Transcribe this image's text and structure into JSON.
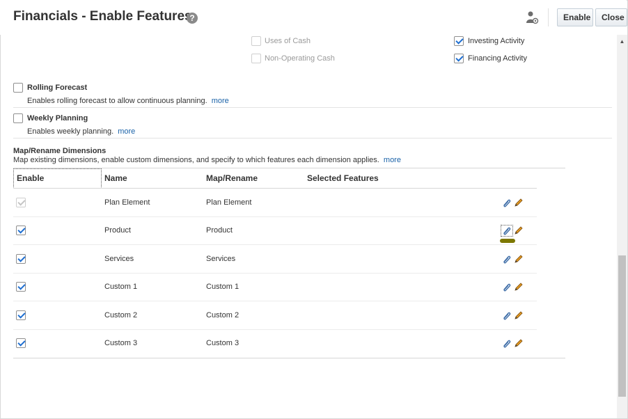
{
  "header": {
    "title": "Financials - Enable Features",
    "help_icon": "?",
    "enable_label": "Enable",
    "close_label": "Close"
  },
  "cashflow": {
    "uses_of_cash": "Uses of Cash",
    "non_operating_cash": "Non-Operating Cash",
    "investing_activity": "Investing Activity",
    "financing_activity": "Financing Activity"
  },
  "rolling_forecast": {
    "label": "Rolling Forecast",
    "description": "Enables rolling forecast to allow continuous planning.",
    "more": "more"
  },
  "weekly_planning": {
    "label": "Weekly Planning",
    "description": "Enables weekly planning.",
    "more": "more"
  },
  "map_section": {
    "title": "Map/Rename Dimensions",
    "description": "Map existing dimensions, enable custom dimensions, and specify to which features each dimension applies.",
    "more": "more"
  },
  "table": {
    "headers": {
      "enable": "Enable",
      "name": "Name",
      "map_rename": "Map/Rename",
      "selected_features": "Selected Features"
    },
    "rows": [
      {
        "enabled": true,
        "disabled": true,
        "name": "Plan Element",
        "map": "Plan Element",
        "features": ""
      },
      {
        "enabled": true,
        "disabled": false,
        "name": "Product",
        "map": "Product",
        "features": ""
      },
      {
        "enabled": true,
        "disabled": false,
        "name": "Services",
        "map": "Services",
        "features": ""
      },
      {
        "enabled": true,
        "disabled": false,
        "name": "Custom 1",
        "map": "Custom 1",
        "features": ""
      },
      {
        "enabled": true,
        "disabled": false,
        "name": "Custom 2",
        "map": "Custom 2",
        "features": ""
      },
      {
        "enabled": true,
        "disabled": false,
        "name": "Custom 3",
        "map": "Custom 3",
        "features": ""
      }
    ]
  },
  "icons": {
    "help": "help-icon",
    "user_settings": "user-settings-icon",
    "attach": "paperclip-icon",
    "edit": "pencil-icon"
  },
  "colors": {
    "link": "#1a62a8",
    "checkmark": "#1f6fd1",
    "highlight": "#7c7700"
  }
}
